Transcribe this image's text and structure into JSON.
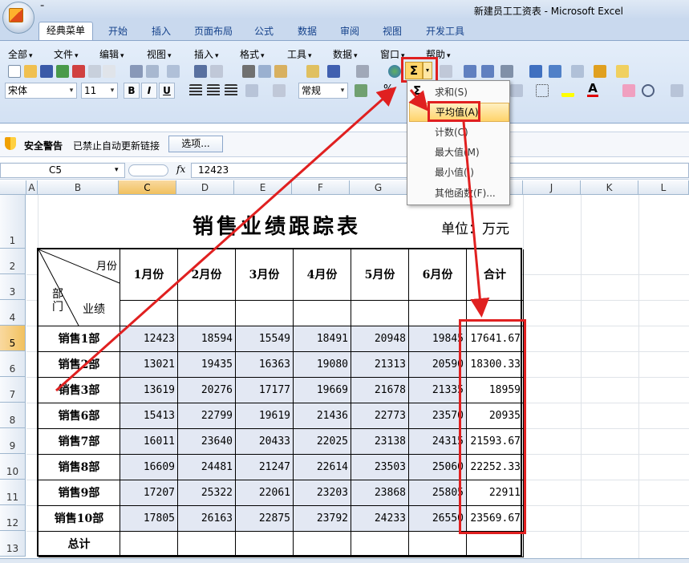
{
  "window": {
    "title": "新建员工工资表 - Microsoft Excel",
    "qat_mark": "⁼"
  },
  "ribbon_tabs": [
    "经典菜单",
    "开始",
    "插入",
    "页面布局",
    "公式",
    "数据",
    "审阅",
    "视图",
    "开发工具"
  ],
  "menus": [
    "全部",
    "文件",
    "编辑",
    "视图",
    "插入",
    "格式",
    "工具",
    "数据",
    "窗口",
    "帮助"
  ],
  "font": {
    "name": "宋体",
    "size": "11"
  },
  "format_buttons": {
    "bold": "B",
    "italic": "I",
    "underline": "U"
  },
  "number_format": "常规",
  "percent": "%",
  "security_bar": {
    "title": "安全警告",
    "message": "已禁止自动更新链接",
    "options_label": "选项..."
  },
  "formula_bar": {
    "name_box": "C5",
    "fx": "fx",
    "value": "12423"
  },
  "autosum": {
    "symbol": "Σ",
    "arrow": "▾"
  },
  "autosum_menu": {
    "symbol": "Σ",
    "items": [
      "求和(S)",
      "平均值(A)",
      "计数(C)",
      "最大值(M)",
      "最小值(I)",
      "其他函数(F)..."
    ],
    "active_index": 1
  },
  "columns": [
    "A",
    "B",
    "C",
    "D",
    "E",
    "F",
    "G",
    "H",
    "I",
    "J",
    "K",
    "L"
  ],
  "selected_column": "C",
  "rows": [
    "1",
    "2",
    "3",
    "4",
    "5",
    "6",
    "7",
    "8",
    "9",
    "10",
    "11",
    "12",
    "13"
  ],
  "selected_row": "5",
  "sheet": {
    "title": "销售业绩跟踪表",
    "unit": "单位：万元",
    "corner": {
      "month": "月份",
      "dept": "部门",
      "perf": "业绩"
    },
    "headers": [
      "1月份",
      "2月份",
      "3月份",
      "4月份",
      "5月份",
      "6月份",
      "合计"
    ],
    "total_label": "总计",
    "rows": [
      {
        "dept": "销售1部",
        "values": [
          "12423",
          "18594",
          "15549",
          "18491",
          "20948",
          "19845",
          "17641.67"
        ]
      },
      {
        "dept": "销售2部",
        "values": [
          "13021",
          "19435",
          "16363",
          "19080",
          "21313",
          "20590",
          "18300.33"
        ]
      },
      {
        "dept": "销售3部",
        "values": [
          "13619",
          "20276",
          "17177",
          "19669",
          "21678",
          "21335",
          "18959"
        ]
      },
      {
        "dept": "销售6部",
        "values": [
          "15413",
          "22799",
          "19619",
          "21436",
          "22773",
          "23570",
          "20935"
        ]
      },
      {
        "dept": "销售7部",
        "values": [
          "16011",
          "23640",
          "20433",
          "22025",
          "23138",
          "24315",
          "21593.67"
        ]
      },
      {
        "dept": "销售8部",
        "values": [
          "16609",
          "24481",
          "21247",
          "22614",
          "23503",
          "25060",
          "22252.33"
        ]
      },
      {
        "dept": "销售9部",
        "values": [
          "17207",
          "25322",
          "22061",
          "23203",
          "23868",
          "25805",
          "22911"
        ]
      },
      {
        "dept": "销售10部",
        "values": [
          "17805",
          "26163",
          "22875",
          "23792",
          "24233",
          "26550",
          "23569.67"
        ]
      }
    ]
  },
  "colors": {
    "highlight": "#e02020",
    "selected_header": "#f1c15f",
    "shade": "#e3e8f3"
  }
}
